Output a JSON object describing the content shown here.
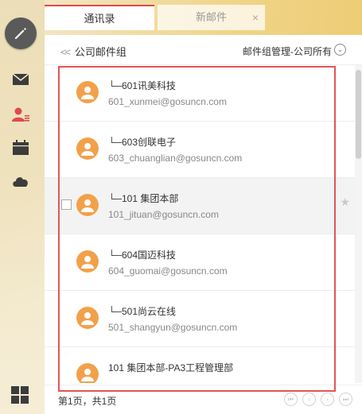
{
  "tabs": [
    {
      "label": "通讯录"
    },
    {
      "label": "新邮件",
      "close": "×"
    }
  ],
  "header": {
    "back_chevron": "<<",
    "title": "公司邮件组",
    "manage_label": "邮件组管理-公司所有",
    "manage_caret": "⌄"
  },
  "contacts": [
    {
      "name": "└─601讯美科技",
      "email": "601_xunmei@gosuncn.com"
    },
    {
      "name": "└─603创联电子",
      "email": "603_chuanglian@gosuncn.com"
    },
    {
      "name": "└─101 集团本部",
      "email": "101_jituan@gosuncn.com",
      "star": "★"
    },
    {
      "name": "└─604国迈科技",
      "email": "604_guomai@gosuncn.com"
    },
    {
      "name": "└─501尚云在线",
      "email": "501_shangyun@gosuncn.com"
    },
    {
      "name": "101 集团本部-PA3工程管理部",
      "email": ""
    }
  ],
  "footer": {
    "page_info": "第1页，共1页",
    "pager": [
      "⏮",
      "‹",
      "›",
      "⏭"
    ]
  },
  "colors": {
    "accent_red": "#e0484a",
    "avatar_orange": "#f2a14a",
    "highlight_red": "#e25555"
  }
}
